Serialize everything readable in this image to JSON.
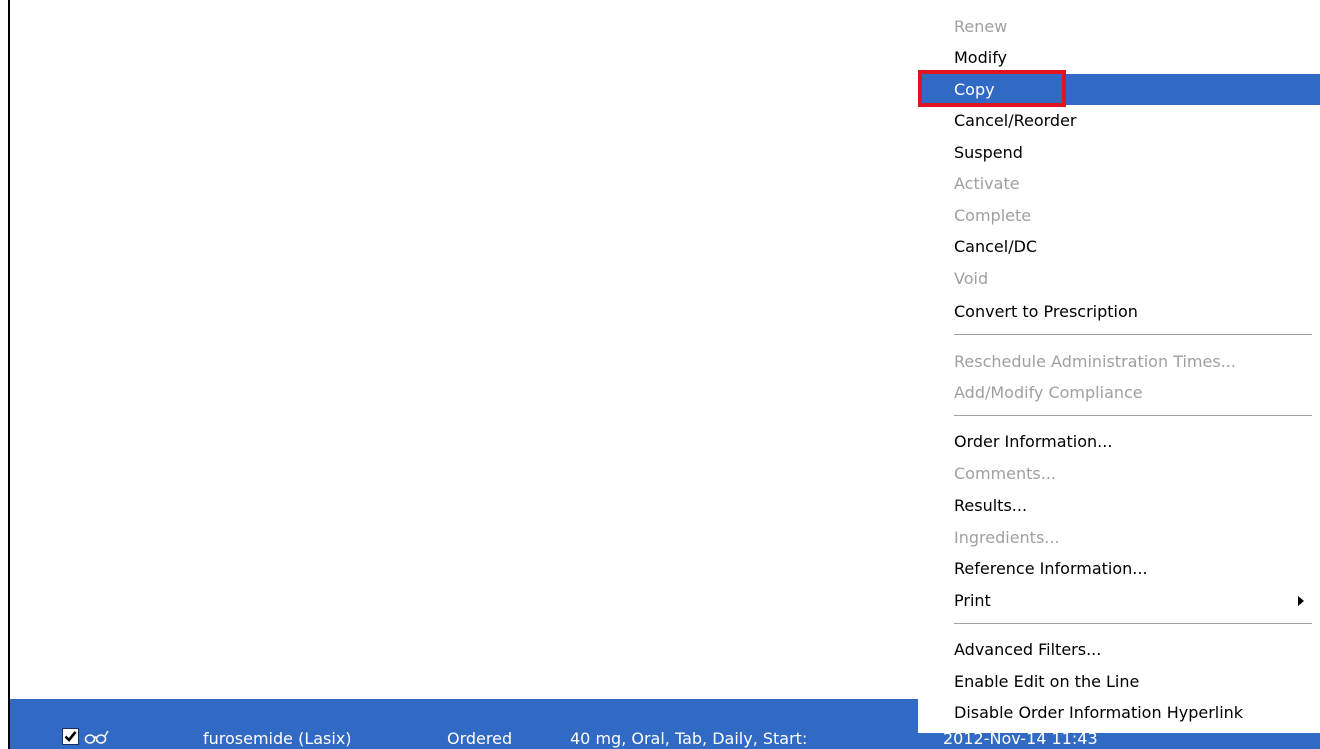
{
  "order_row": {
    "checked": true,
    "icon": "glasses-icon",
    "medication": "furosemide (Lasix)",
    "status": "Ordered",
    "details": "40 mg, Oral, Tab, Daily, Start:",
    "start_time": "2012-Nov-14 11:43"
  },
  "context_menu": {
    "items": [
      {
        "label": "Renew",
        "enabled": false
      },
      {
        "label": "Modify",
        "enabled": true
      },
      {
        "label": "Copy",
        "enabled": true,
        "highlighted": true
      },
      {
        "label": "Cancel/Reorder",
        "enabled": true
      },
      {
        "label": "Suspend",
        "enabled": true
      },
      {
        "label": "Activate",
        "enabled": false
      },
      {
        "label": "Complete",
        "enabled": false
      },
      {
        "label": "Cancel/DC",
        "enabled": true
      },
      {
        "label": "Void",
        "enabled": false
      },
      {
        "label": "Convert to Prescription",
        "enabled": true
      },
      {
        "label": "Reschedule Administration Times...",
        "enabled": false
      },
      {
        "label": "Add/Modify Compliance",
        "enabled": false
      },
      {
        "label": "Order Information...",
        "enabled": true
      },
      {
        "label": "Comments...",
        "enabled": false
      },
      {
        "label": "Results...",
        "enabled": true
      },
      {
        "label": "Ingredients...",
        "enabled": false
      },
      {
        "label": "Reference Information...",
        "enabled": true
      },
      {
        "label": "Print",
        "enabled": true,
        "submenu": true
      },
      {
        "label": "Advanced Filters...",
        "enabled": true
      },
      {
        "label": "Enable Edit on the Line",
        "enabled": true
      },
      {
        "label": "Disable Order Information Hyperlink",
        "enabled": true
      }
    ]
  },
  "colors": {
    "selection": "#316ac5",
    "disabled_text": "#a0a0a0",
    "annotation_box": "#e0141e"
  }
}
